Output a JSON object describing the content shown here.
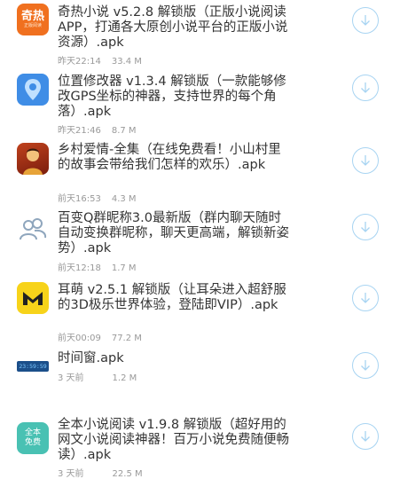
{
  "items": [
    {
      "title": "奇热小说 v5.2.8 解锁版（正版小说阅读APP，打通各大原创小说平台的正版小说资源）.apk",
      "time": "昨天22:14",
      "size": "33.4 M",
      "icon": "qire-app-icon",
      "icon_text": "奇热",
      "icon_subtext": "正版阅读"
    },
    {
      "title": "位置修改器 v1.3.4 解锁版（一款能够修改GPS坐标的神器，支持世界的每个角落）.apk",
      "time": "昨天21:46",
      "size": "8.7 M",
      "icon": "location-pin-app-icon"
    },
    {
      "title": "乡村爱情-全集（在线免费看！小山村里的故事会带给我们怎样的欢乐）.apk",
      "time": "前天16:53",
      "size": "4.3 M",
      "icon": "village-drama-app-icon"
    },
    {
      "title": "百变Q群昵称3.0最新版（群内聊天随时自动变换群昵称，聊天更高端，解锁新姿势）.apk",
      "time": "前天12:18",
      "size": "1.7 M",
      "icon": "contacts-app-icon"
    },
    {
      "title": "耳萌 v2.5.1 解锁版（让耳朵进入超舒服的3D极乐世界体验，登陆即VIP）.apk",
      "time": "前天00:09",
      "size": "77.2 M",
      "icon": "ermeng-app-icon"
    },
    {
      "title": "时间窗.apk",
      "time": "3 天前",
      "size": "1.2 M",
      "icon": "clock-app-icon",
      "icon_text": "23:59:59"
    },
    {
      "title": "全本小说阅读 v1.9.8 解锁版（超好用的网文小说阅读神器！百万小说免费随便畅读）.apk",
      "time": "3 天前",
      "size": "22.5 M",
      "icon": "quanben-reader-app-icon",
      "icon_text": "全本",
      "icon_subtext": "免费"
    }
  ],
  "colors": {
    "title": "#333333",
    "meta": "#999999",
    "download_ring": "#a8d4f2",
    "accent": "#2f9be8"
  }
}
